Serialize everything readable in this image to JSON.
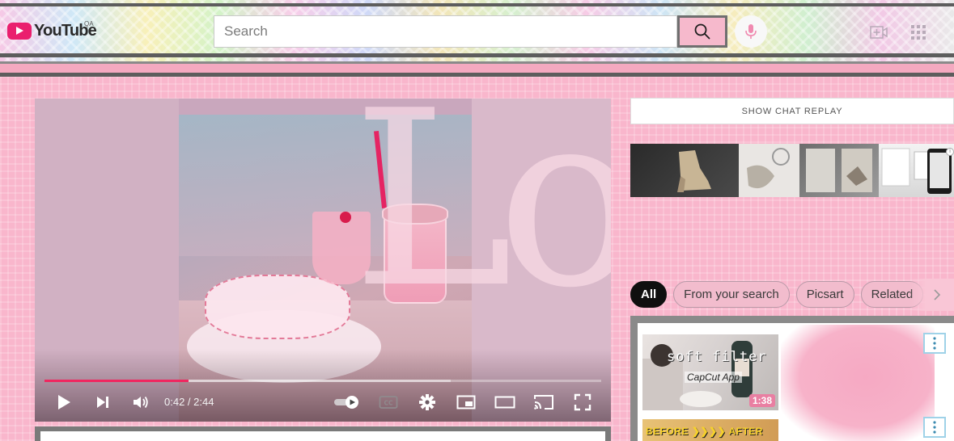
{
  "header": {
    "logo_text": "YouTube",
    "country_code": "QA",
    "search_placeholder": "Search",
    "search_icon": "search-icon",
    "mic_icon": "microphone-icon",
    "create_icon": "create-video-icon",
    "apps_icon": "apps-grid-icon"
  },
  "player": {
    "overlay_text": "Lol",
    "current_time": "0:42",
    "duration": "2:44",
    "time_display": "0:42 / 2:44",
    "progress_fraction": 0.258,
    "controls": {
      "play": "play-icon",
      "next": "next-icon",
      "volume": "volume-icon",
      "autoplay": "autoplay-toggle",
      "captions": "cc-icon",
      "settings": "gear-icon",
      "miniplayer": "miniplayer-icon",
      "theater": "theater-mode-icon",
      "cast": "cast-icon",
      "fullscreen": "fullscreen-icon"
    }
  },
  "sidebar": {
    "chat_replay_label": "SHOW CHAT REPLAY",
    "chips": [
      "All",
      "From your search",
      "Picsart",
      "Related"
    ],
    "active_chip": "All",
    "recommendations": [
      {
        "thumb_title": "soft filter",
        "thumb_subtitle": "CapCut App",
        "duration": "1:38"
      },
      {
        "thumb_text": "BEFORE ❯❯❯❯ AFTER"
      }
    ]
  },
  "colors": {
    "accent_pink": "#f9b6cc",
    "progress_red": "#f0265f",
    "logo_red": "#ea1f6e"
  }
}
